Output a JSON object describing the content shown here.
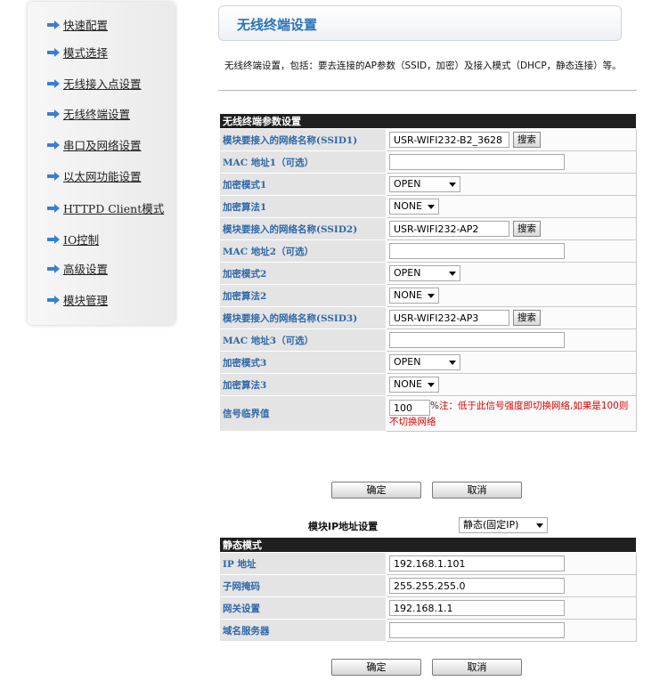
{
  "sidebar": {
    "items": [
      {
        "label": "快速配置"
      },
      {
        "label": "模式选择"
      },
      {
        "label": "无线接入点设置"
      },
      {
        "label": "无线终端设置"
      },
      {
        "label": "串口及网络设置"
      },
      {
        "label": "以太网功能设置"
      },
      {
        "label": "HTTPD Client模式"
      },
      {
        "label": "IO控制"
      },
      {
        "label": "高级设置"
      },
      {
        "label": "模块管理"
      }
    ]
  },
  "header": {
    "title": "无线终端设置",
    "description": "无线终端设置，包括：要去连接的AP参数（SSID，加密）及接入模式（DHCP，静态连接）等。"
  },
  "sta_table": {
    "heading": "无线终端参数设置",
    "ssid1_label": "模块要接入的网络名称(SSID1)",
    "ssid1_value": "USR-WIFI232-B2_3628",
    "search_label": "搜索",
    "mac1_label": "MAC 地址1（可选）",
    "mac1_value": "",
    "enc_mode1_label": "加密模式1",
    "enc_mode1_value": "OPEN",
    "enc_alg1_label": "加密算法1",
    "enc_alg1_value": "NONE",
    "ssid2_label": "模块要接入的网络名称(SSID2)",
    "ssid2_value": "USR-WIFI232-AP2",
    "mac2_label": "MAC 地址2（可选）",
    "mac2_value": "",
    "enc_mode2_label": "加密模式2",
    "enc_mode2_value": "OPEN",
    "enc_alg2_label": "加密算法2",
    "enc_alg2_value": "NONE",
    "ssid3_label": "模块要接入的网络名称(SSID3)",
    "ssid3_value": "USR-WIFI232-AP3",
    "mac3_label": "MAC 地址3（可选）",
    "mac3_value": "",
    "enc_mode3_label": "加密模式3",
    "enc_mode3_value": "OPEN",
    "enc_alg3_label": "加密算法3",
    "enc_alg3_value": "NONE",
    "threshold_label": "信号临界值",
    "threshold_value": "100",
    "threshold_unit": "%",
    "threshold_note": "注：低于此信号强度即切换网络,如果是100则不切换网络"
  },
  "buttons": {
    "ok": "确定",
    "cancel": "取消"
  },
  "ip_mode": {
    "label": "模块IP地址设置",
    "value": "静态(固定IP)"
  },
  "static_table": {
    "heading": "静态模式",
    "ip_label": "IP 地址",
    "ip_value": "192.168.1.101",
    "mask_label": "子网掩码",
    "mask_value": "255.255.255.0",
    "gateway_label": "网关设置",
    "gateway_value": "192.168.1.1",
    "dns_label": "域名服务器",
    "dns_value": ""
  },
  "colors": {
    "label_blue": "#2f67a8",
    "title_blue": "#2a73b8",
    "note_red": "#e00000",
    "arrow_blue": "#3a7fd0"
  }
}
